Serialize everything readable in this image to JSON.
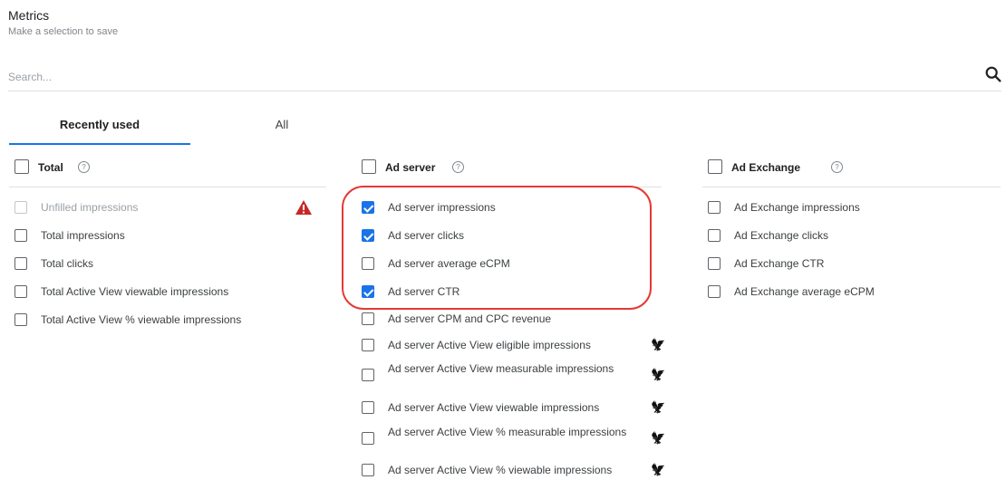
{
  "header": {
    "title": "Metrics",
    "subtitle": "Make a selection to save"
  },
  "search": {
    "placeholder": "Search..."
  },
  "tabs": [
    {
      "label": "Recently used",
      "active": true
    },
    {
      "label": "All",
      "active": false
    }
  ],
  "columns": [
    {
      "title": "Total",
      "items": [
        {
          "label": "Unfilled impressions",
          "checked": false,
          "disabled": true,
          "warning": true
        },
        {
          "label": "Total impressions",
          "checked": false
        },
        {
          "label": "Total clicks",
          "checked": false
        },
        {
          "label": "Total Active View viewable impressions",
          "checked": false
        },
        {
          "label": "Total Active View % viewable impressions",
          "checked": false
        }
      ]
    },
    {
      "title": "Ad server",
      "items": [
        {
          "label": "Ad server impressions",
          "checked": true
        },
        {
          "label": "Ad server clicks",
          "checked": true
        },
        {
          "label": "Ad server average eCPM",
          "checked": false
        },
        {
          "label": "Ad server CTR",
          "checked": true
        },
        {
          "label": "Ad server CPM and CPC revenue",
          "checked": false
        },
        {
          "label": "Ad server Active View eligible impressions",
          "checked": false,
          "badge": "bird-icon"
        },
        {
          "label": "Ad server Active View measurable impressions",
          "checked": false,
          "badge": "bird-icon"
        },
        {
          "label": "Ad server Active View viewable impressions",
          "checked": false,
          "badge": "bird-icon"
        },
        {
          "label": "Ad server Active View % measurable impressions",
          "checked": false,
          "badge": "bird-icon"
        },
        {
          "label": "Ad server Active View % viewable impressions",
          "checked": false,
          "badge": "bird-icon"
        }
      ]
    },
    {
      "title": "Ad Exchange",
      "items": [
        {
          "label": "Ad Exchange impressions",
          "checked": false
        },
        {
          "label": "Ad Exchange clicks",
          "checked": false
        },
        {
          "label": "Ad Exchange CTR",
          "checked": false
        },
        {
          "label": "Ad Exchange average eCPM",
          "checked": false
        }
      ]
    }
  ],
  "colors": {
    "accent": "#1a73e8",
    "highlight": "#e53935",
    "warning": "#c62828"
  }
}
